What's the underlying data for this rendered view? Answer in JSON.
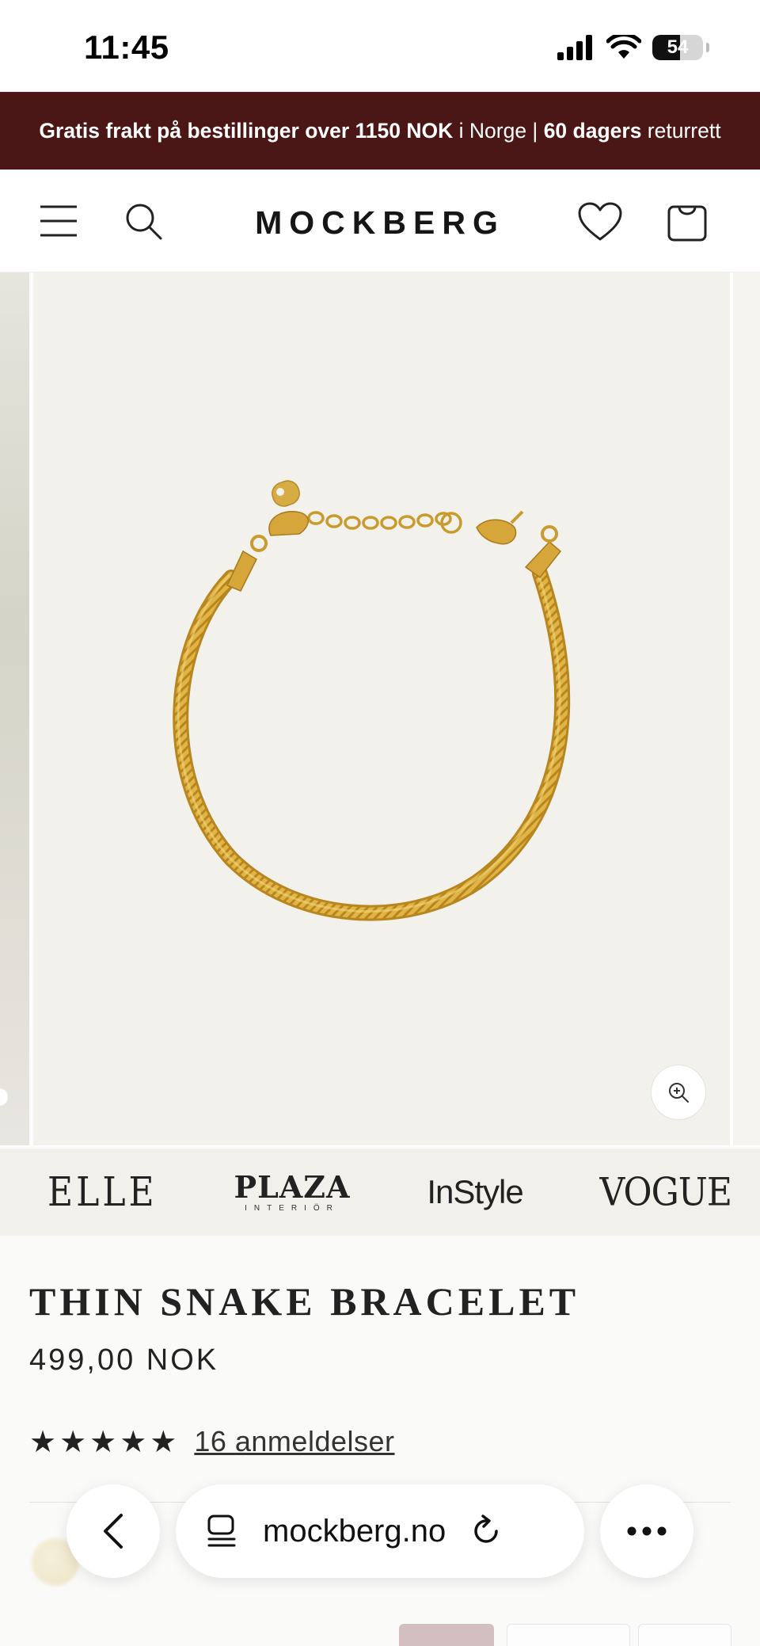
{
  "status_bar": {
    "time": "11:45",
    "battery": "54",
    "battery_level": 0.54
  },
  "promo": {
    "part1": "Gratis frakt på bestillinger over 1150 NOK",
    "part2": " i Norge | ",
    "part3": "60 dagers",
    "part4": " returrett"
  },
  "header": {
    "logo": "MOCKBERG",
    "icons": [
      "menu-icon",
      "search-icon",
      "heart-icon",
      "bag-icon"
    ]
  },
  "gallery": {
    "zoom_icon": "zoom-in-icon"
  },
  "press": {
    "logos": [
      "ELLE",
      "PLAZA",
      "INTERIÖR",
      "InStyle",
      "VOGUE"
    ]
  },
  "product": {
    "title": "THIN SNAKE BRACELET",
    "price": "499,00 NOK",
    "rating": 5,
    "stars": "★★★★★",
    "reviews_label": "16 anmeldelser"
  },
  "browser": {
    "url": "mockberg.no",
    "icons": [
      "back-chevron-icon",
      "tabs-icon",
      "reload-icon",
      "more-icon"
    ]
  },
  "colors": {
    "banner_bg": "#4a1716",
    "product_bg": "#f3f1ec",
    "press_bg": "#f1f0eb",
    "gold": "#d6a72f"
  }
}
